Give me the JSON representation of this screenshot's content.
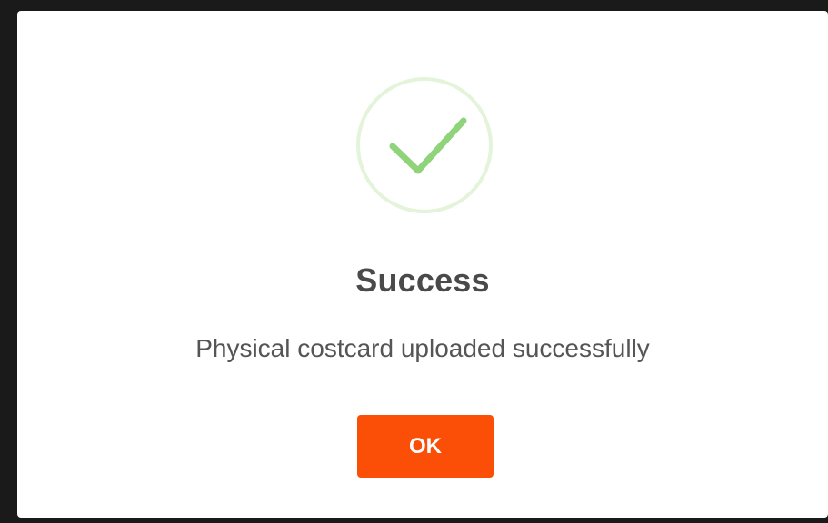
{
  "dialog": {
    "icon": "checkmark-icon",
    "title": "Success",
    "message": "Physical costcard uploaded successfully",
    "ok_label": "OK"
  },
  "colors": {
    "accent_button": "#fb4f08",
    "check_stroke": "#8fd37a",
    "icon_ring": "#e3f4da",
    "title_text": "#4a4a4a",
    "message_text": "#555555"
  }
}
